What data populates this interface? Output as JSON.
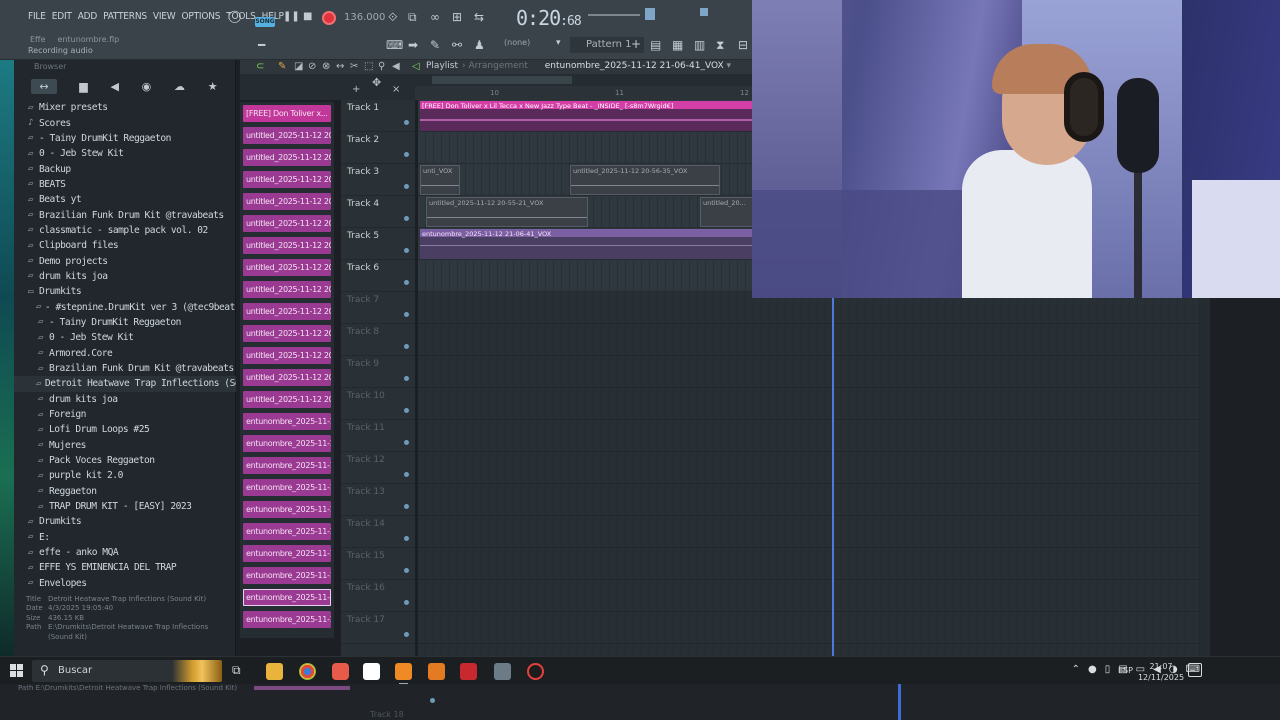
{
  "menu": [
    "FILE",
    "EDIT",
    "ADD",
    "PATTERNS",
    "VIEW",
    "OPTIONS",
    "TOOLS",
    "HELP"
  ],
  "transport": {
    "song_label": "SONG",
    "tempo": "136.000",
    "time": "0:20",
    "time_frac": ":68",
    "pattern": "Pattern 1",
    "snap": "(none)",
    "project_file": "entunombre.flp",
    "effect_hint": "Effe",
    "status": "Recording audio"
  },
  "browser": {
    "header": "Browser",
    "items": [
      {
        "label": "Mixer presets",
        "icon": "folder",
        "indent": 0
      },
      {
        "label": "Scores",
        "icon": "note",
        "indent": 0
      },
      {
        "label": " - Tainy DrumKit Reggaeton",
        "icon": "folder",
        "indent": 0
      },
      {
        "label": "0 - Jeb Stew Kit",
        "icon": "folder",
        "indent": 0
      },
      {
        "label": "Backup",
        "icon": "folder",
        "indent": 0
      },
      {
        "label": "BEATS",
        "icon": "folder",
        "indent": 0
      },
      {
        "label": "Beats yt",
        "icon": "folder",
        "indent": 0
      },
      {
        "label": "Brazilian Funk Drum Kit @travabeats",
        "icon": "folder",
        "indent": 0
      },
      {
        "label": "classmatic - sample pack vol. 02",
        "icon": "folder",
        "indent": 0
      },
      {
        "label": "Clipboard files",
        "icon": "folder",
        "indent": 0
      },
      {
        "label": "Demo projects",
        "icon": "folder",
        "indent": 0
      },
      {
        "label": "drum kits joa",
        "icon": "folder",
        "indent": 0
      },
      {
        "label": "Drumkits",
        "icon": "folder-open",
        "indent": 0
      },
      {
        "label": " - #stepnine.DrumKit ver 3 (@tec9beat)",
        "icon": "folder",
        "indent": 1
      },
      {
        "label": " - Tainy DrumKit Reggaeton",
        "icon": "folder",
        "indent": 1
      },
      {
        "label": "0 - Jeb Stew Kit",
        "icon": "folder",
        "indent": 1
      },
      {
        "label": "Armored.Core",
        "icon": "folder",
        "indent": 1
      },
      {
        "label": "Brazilian Funk Drum Kit @travabeats",
        "icon": "folder",
        "indent": 1
      },
      {
        "label": "Detroit Heatwave Trap Inflections (Sound Kit)",
        "icon": "folder",
        "indent": 1,
        "selected": true
      },
      {
        "label": "drum kits joa",
        "icon": "folder",
        "indent": 1
      },
      {
        "label": "Foreign",
        "icon": "folder",
        "indent": 1
      },
      {
        "label": "Lofi Drum Loops #25",
        "icon": "folder",
        "indent": 1
      },
      {
        "label": "Mujeres",
        "icon": "folder",
        "indent": 1
      },
      {
        "label": "Pack Voces Reggaeton",
        "icon": "folder",
        "indent": 1
      },
      {
        "label": "purple kit 2.0",
        "icon": "folder",
        "indent": 1
      },
      {
        "label": "Reggaeton",
        "icon": "folder",
        "indent": 1
      },
      {
        "label": "TRAP DRUM KIT - [EASY] 2023",
        "icon": "folder",
        "indent": 1
      },
      {
        "label": "Drumkits",
        "icon": "folder",
        "indent": 0
      },
      {
        "label": "E:",
        "icon": "folder",
        "indent": 0
      },
      {
        "label": "effe - anko MQA",
        "icon": "folder",
        "indent": 0
      },
      {
        "label": "EFFE YS EMINENCIA DEL TRAP",
        "icon": "folder",
        "indent": 0
      },
      {
        "label": "Envelopes",
        "icon": "folder",
        "indent": 0
      }
    ],
    "info": {
      "title_key": "Title",
      "title": "Detroit Heatwave Trap Inflections (Sound Kit)",
      "date_key": "Date",
      "date": "4/3/2025 19:05:40",
      "size_key": "Size",
      "size": "436.15 KB",
      "path_key": "Path",
      "path": "E:\\Drumkits\\Detroit Heatwave Trap Inflections (Sound Kit)"
    }
  },
  "playlist": {
    "title": "Playlist",
    "subtitle": "Arrangement",
    "file": "entunombre_2025-11-12 21-06-41_VOX",
    "ruler": [
      "10",
      "11",
      "12"
    ],
    "pattern_clips": [
      "[FREE] Don Toliver x...",
      "untitled_2025-11-12 20-...",
      "untitled_2025-11-12 20-...",
      "untitled_2025-11-12 20-...",
      "untitled_2025-11-12 20-...",
      "untitled_2025-11-12 20-...",
      "untitled_2025-11-12 20-...",
      "untitled_2025-11-12 20-...",
      "untitled_2025-11-12 20-...",
      "untitled_2025-11-12 20-...",
      "untitled_2025-11-12 20-...",
      "untitled_2025-11-12 20-...",
      "untitled_2025-11-12 20-...",
      "untitled_2025-11-12 20-...",
      "entunombre_2025-11-12...",
      "entunombre_2025-11-12...",
      "entunombre_2025-11-12...",
      "entunombre_2025-11-12...",
      "entunombre_2025-11-12...",
      "entunombre_2025-11-12...",
      "entunombre_2025-11-12...",
      "entunombre_2025-11-12...",
      "entunombre_2025-11-12...",
      "entunombre_2025-11-12..."
    ],
    "tracks": [
      "Track 1",
      "Track 2",
      "Track 3",
      "Track 4",
      "Track 5",
      "Track 6",
      "Track 7",
      "Track 8",
      "Track 9",
      "Track 10",
      "Track 11",
      "Track 12",
      "Track 13",
      "Track 14",
      "Track 15",
      "Track 16",
      "Track 17",
      "Track 18"
    ],
    "clips": {
      "t1": "[FREE] Don Toliver x Lil Tecca x New Jazz Type Beat - _INSIDE_ [-s8m7Wrgid€]",
      "t3a": "unti_VOX",
      "t3b": "untitled_2025-11-12 20-56-35_VOX",
      "t4a": "untitled_2025-11-12 20-55-21_VOX",
      "t4b": "untitled_20...",
      "t5": "entunombre_2025-11-12 21-06-41_VOX"
    }
  },
  "taskbar": {
    "search": "Buscar",
    "lang": "ESP",
    "time": "21:07",
    "date": "12/11/2025"
  },
  "colors": {
    "accent": "#d43ea7",
    "playhead": "#4f7ad9",
    "record": "#e0343c",
    "clip_pattern": "#9a3a93"
  }
}
